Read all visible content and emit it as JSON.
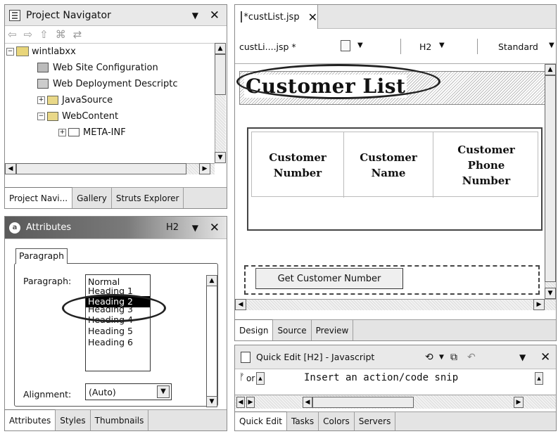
{
  "navigator": {
    "title": "Project Navigator",
    "tree": [
      {
        "label": "wintlabxx",
        "expander": "−"
      },
      {
        "label": "Web Site Configuration",
        "expander": ""
      },
      {
        "label": "Web Deployment Descriptc",
        "expander": ""
      },
      {
        "label": "JavaSource",
        "expander": "+"
      },
      {
        "label": "WebContent",
        "expander": "−"
      },
      {
        "label": "META-INF",
        "expander": "+"
      }
    ],
    "tabs": [
      "Project Navi...",
      "Gallery",
      "Struts Explorer"
    ]
  },
  "attributes": {
    "title": "Attributes",
    "tag": "H2",
    "section_tab": "Paragraph",
    "paragraph_label": "Paragraph:",
    "paragraph_options": [
      "Normal",
      "Heading 1",
      "Heading 2",
      "Heading 3",
      "Heading 4",
      "Heading 5",
      "Heading 6"
    ],
    "selected_option": "Heading 2",
    "alignment_label": "Alignment:",
    "alignment_value": "(Auto)",
    "tabs": [
      "Attributes",
      "Styles",
      "Thumbnails"
    ]
  },
  "editor": {
    "file_tab": "*custList.jsp",
    "toolbar": {
      "file_label": "custLi....jsp *",
      "tag_value": "H2",
      "mode_value": "Standard"
    },
    "page": {
      "heading": "Customer List",
      "table_headers": [
        "Customer Number",
        "Customer Name",
        "Customer Phone Number"
      ],
      "button_label": "Get Customer Number"
    },
    "tabs": [
      "Design",
      "Source",
      "Preview"
    ]
  },
  "quick_edit": {
    "title": "Quick Edit [H2] - Javascript",
    "event_label": "or",
    "placeholder": "Insert an action/code snip",
    "tabs": [
      "Quick Edit",
      "Tasks",
      "Colors",
      "Servers"
    ]
  },
  "colors": {
    "selection": "#000000",
    "gradient_dark": "#5a5a5a",
    "tab_bg": "#e4e4e4"
  }
}
